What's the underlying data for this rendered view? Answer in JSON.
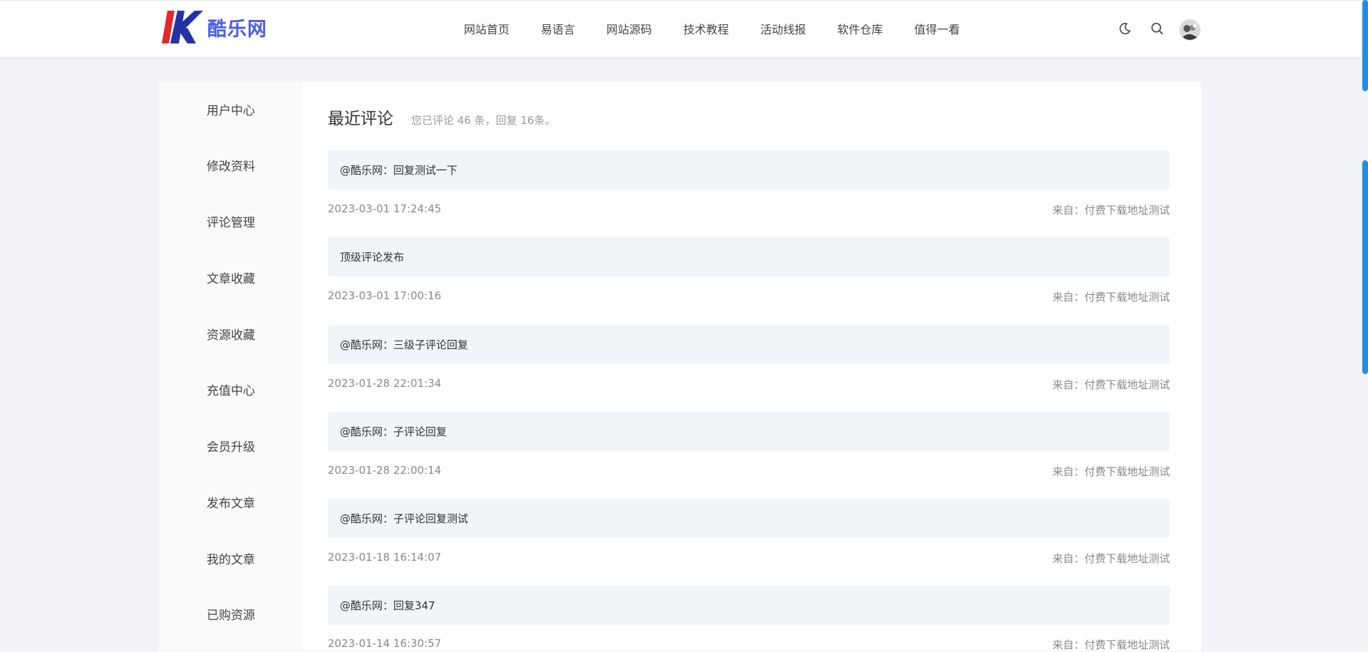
{
  "site": {
    "name": "酷乐网",
    "brand_color": "#4a5ee6",
    "logo_red": "#e02a2a",
    "logo_blue": "#2233a8"
  },
  "nav": [
    "网站首页",
    "易语言",
    "网站源码",
    "技术教程",
    "活动线报",
    "软件仓库",
    "值得一看"
  ],
  "header_icons": [
    "moon-icon",
    "search-icon",
    "avatar"
  ],
  "sidebar": [
    "用户中心",
    "修改资料",
    "评论管理",
    "文章收藏",
    "资源收藏",
    "充值中心",
    "会员升级",
    "发布文章",
    "我的文章",
    "已购资源"
  ],
  "page": {
    "title": "最近评论",
    "subtitle": "您已评论 46 条，回复 16条。"
  },
  "comments": [
    {
      "text": "@酷乐网：回复测试一下",
      "date": "2023-03-01 17:24:45",
      "source": "来自：付费下载地址测试"
    },
    {
      "text": "顶级评论发布",
      "date": "2023-03-01 17:00:16",
      "source": "来自：付费下载地址测试"
    },
    {
      "text": "@酷乐网：三级子评论回复",
      "date": "2023-01-28 22:01:34",
      "source": "来自：付费下载地址测试"
    },
    {
      "text": "@酷乐网：子评论回复",
      "date": "2023-01-28 22:00:14",
      "source": "来自：付费下载地址测试"
    },
    {
      "text": "@酷乐网：子评论回复测试",
      "date": "2023-01-18 16:14:07",
      "source": "来自：付费下载地址测试"
    },
    {
      "text": "@酷乐网：回复347",
      "date": "2023-01-14 16:30:57",
      "source": "来自：付费下载地址测试"
    }
  ]
}
